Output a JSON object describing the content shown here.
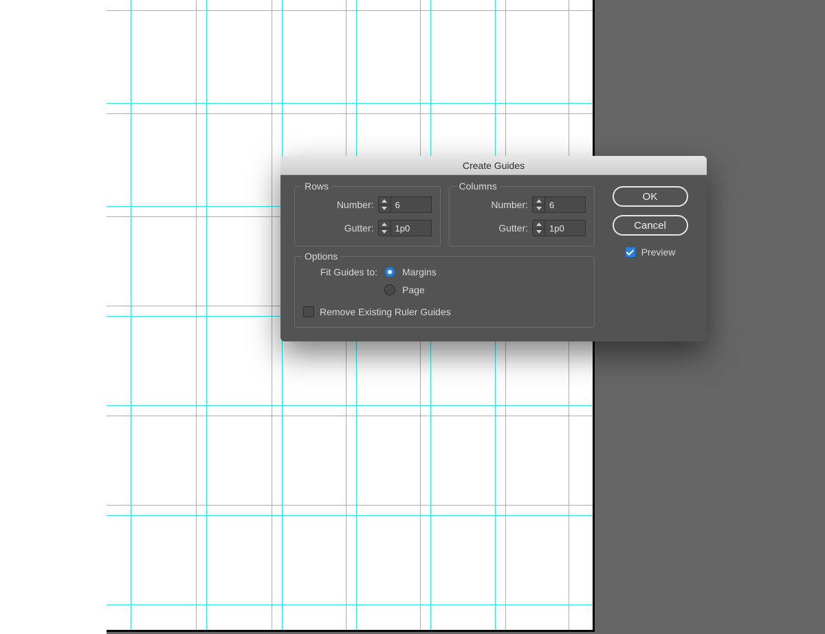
{
  "dialog": {
    "title": "Create Guides",
    "rows_group": {
      "legend": "Rows",
      "number_label": "Number:",
      "number_value": "6",
      "gutter_label": "Gutter:",
      "gutter_value": "1p0"
    },
    "columns_group": {
      "legend": "Columns",
      "number_label": "Number:",
      "number_value": "6",
      "gutter_label": "Gutter:",
      "gutter_value": "1p0"
    },
    "options_group": {
      "legend": "Options",
      "fit_label": "Fit Guides to:",
      "radio_margins": "Margins",
      "radio_page": "Page",
      "remove_guides": "Remove Existing Ruler Guides"
    },
    "buttons": {
      "ok": "OK",
      "cancel": "Cancel",
      "preview": "Preview"
    }
  },
  "canvas": {
    "rows": 6,
    "columns": 6
  }
}
